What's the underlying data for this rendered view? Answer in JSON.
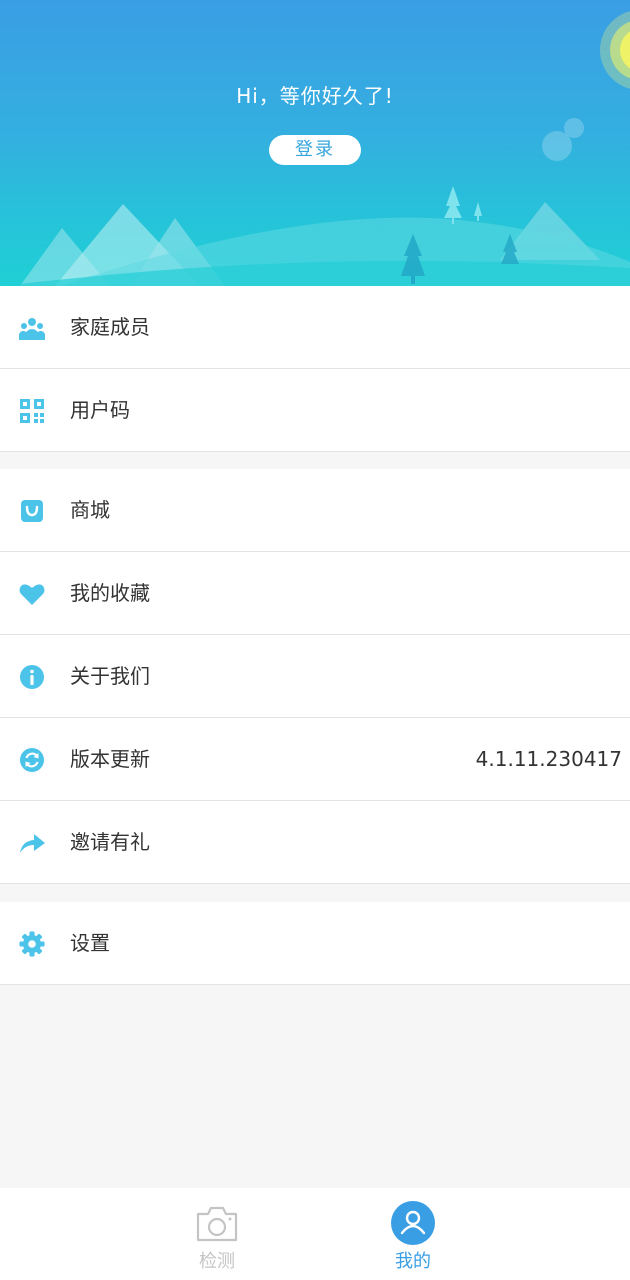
{
  "header": {
    "greeting": "Hi，等你好久了!",
    "login_label": "登录"
  },
  "menu_group_1": [
    {
      "label": "家庭成员",
      "icon": "family-icon"
    },
    {
      "label": "用户码",
      "icon": "qrcode-icon"
    }
  ],
  "menu_group_2": [
    {
      "label": "商城",
      "icon": "shop-bag-icon"
    },
    {
      "label": "我的收藏",
      "icon": "heart-icon"
    },
    {
      "label": "关于我们",
      "icon": "info-icon"
    },
    {
      "label": "版本更新",
      "icon": "refresh-icon",
      "value": "4.1.11.230417"
    },
    {
      "label": "邀请有礼",
      "icon": "share-icon"
    }
  ],
  "menu_group_3": [
    {
      "label": "设置",
      "icon": "gear-icon"
    }
  ],
  "tabbar": {
    "tabs": [
      {
        "label": "检测",
        "icon": "camera-icon",
        "active": false
      },
      {
        "label": "我的",
        "icon": "user-icon",
        "active": true
      }
    ]
  },
  "colors": {
    "accent": "#3a9ee4",
    "icon": "#4cc3e8",
    "inactive": "#c4c4c4"
  }
}
